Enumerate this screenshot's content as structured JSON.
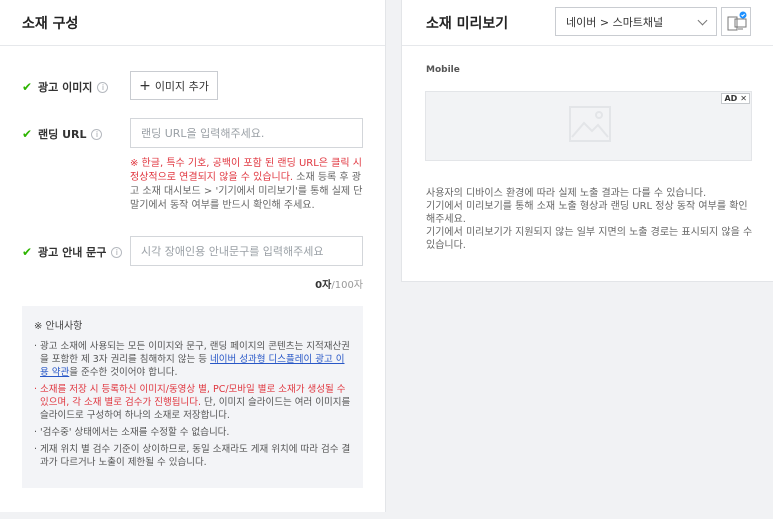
{
  "left": {
    "title": "소재 구성",
    "ad_image": {
      "label": "광고 이미지",
      "button": "이미지 추가"
    },
    "landing_url": {
      "label": "랜딩 URL",
      "placeholder": "랜딩 URL을 입력해주세요.",
      "notice_red": "※ 한글, 특수 기호, 공백이 포함 된 랜딩 URL은 클릭 시 정상적으로 연결되지 않을 수 있습니다.",
      "notice_gray": " 소재 등록 후 광고 소재 대시보드 > '기기에서 미리보기'를 통해 실제 단말기에서 동작 여부를 반드시 확인해 주세요."
    },
    "ad_guide_text": {
      "label": "광고 안내 문구",
      "placeholder": "시각 장애인용 안내문구를 입력해주세요",
      "count": "0자",
      "max": "/100자"
    },
    "guide": {
      "title": "※ 안내사항",
      "item1_pre": "· 광고 소재에 사용되는 모든 이미지와 문구, 랜딩 페이지의 콘텐츠는 지적재산권을 포함한 제 3자 권리를 침해하지 않는 등 ",
      "item1_link": "네이버 성과형 디스플레이 광고 이용 약관",
      "item1_post": "을 준수한 것이어야 합니다.",
      "item2_red": "· 소재를 저장 시 등록하신 이미지/동영상 별, PC/모바일 별로 소재가 생성될 수 있으며, 각 소재 별로 검수가 진행됩니다.",
      "item2_gray": " 단, 이미지 슬라이드는 여러 이미지를 슬라이드로 구성하여 하나의 소재로 저장합니다.",
      "item3": "· '검수중' 상태에서는 소재를 수정할 수 없습니다.",
      "item4": "· 게재 위치 별 검수 기준이 상이하므로, 동일 소재라도 게재 위치에 따라 검수 결과가 다르거나 노출이 제한될 수 있습니다."
    }
  },
  "right": {
    "title": "소재 미리보기",
    "placement_select": "네이버 > 스마트채널",
    "device_icon": "device-toggle-icon",
    "mobile_label": "Mobile",
    "ad_badge": "AD",
    "description": "사용자의 디바이스 환경에 따라 실제 노출 결과는 다를 수 있습니다.\n기기에서 미리보기를 통해 소재 노출 형상과 랜딩 URL 정상 동작 여부를 확인해주세요.\n기기에서 미리보기가 지원되지 않는 일부 지면의 노출 경로는 표시되지 않을 수 있습니다."
  },
  "colors": {
    "check_green": "#2db400",
    "notice_red": "#e0363f",
    "link_blue": "#2857c7",
    "device_accent": "#1e90ff"
  }
}
